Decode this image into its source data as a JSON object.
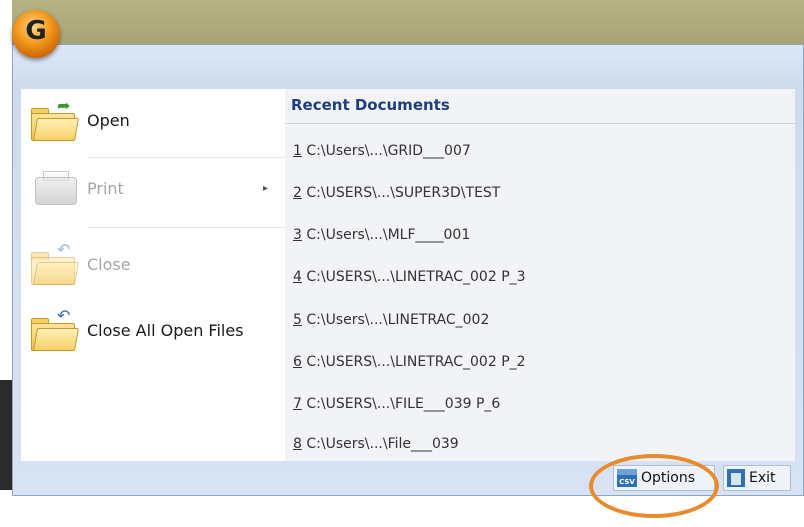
{
  "app_button": {
    "glyph": "G"
  },
  "menu": {
    "commands": [
      {
        "key": "open",
        "label": "Open",
        "enabled": true
      },
      {
        "key": "print",
        "label": "Print",
        "enabled": false,
        "submenu": true
      },
      {
        "key": "close",
        "label": "Close",
        "enabled": false
      },
      {
        "key": "close_all",
        "label": "Close All Open Files",
        "enabled": true
      }
    ],
    "submenu_arrow": "▸"
  },
  "recent": {
    "title": "Recent Documents",
    "items": [
      {
        "num": "1",
        "path": " C:\\Users\\...\\GRID___007"
      },
      {
        "num": "2",
        "path": " C:\\USERS\\...\\SUPER3D\\TEST"
      },
      {
        "num": "3",
        "path": " C:\\Users\\...\\MLF____001"
      },
      {
        "num": "4",
        "path": " C:\\USERS\\...\\LINETRAC_002 P_3"
      },
      {
        "num": "5",
        "path": " C:\\Users\\...\\LINETRAC_002"
      },
      {
        "num": "6",
        "path": " C:\\USERS\\...\\LINETRAC_002 P_2"
      },
      {
        "num": "7",
        "path": " C:\\USERS\\...\\FILE___039 P_6"
      },
      {
        "num": "8",
        "path": " C:\\Users\\...\\File___039"
      }
    ]
  },
  "footer": {
    "options_label": "Options",
    "exit_label": "Exit",
    "csv_icon_text": "CSV"
  },
  "colors": {
    "highlight": "#e98a2c",
    "recent_title": "#1f3f7a",
    "frame": "#d7e3f3"
  }
}
